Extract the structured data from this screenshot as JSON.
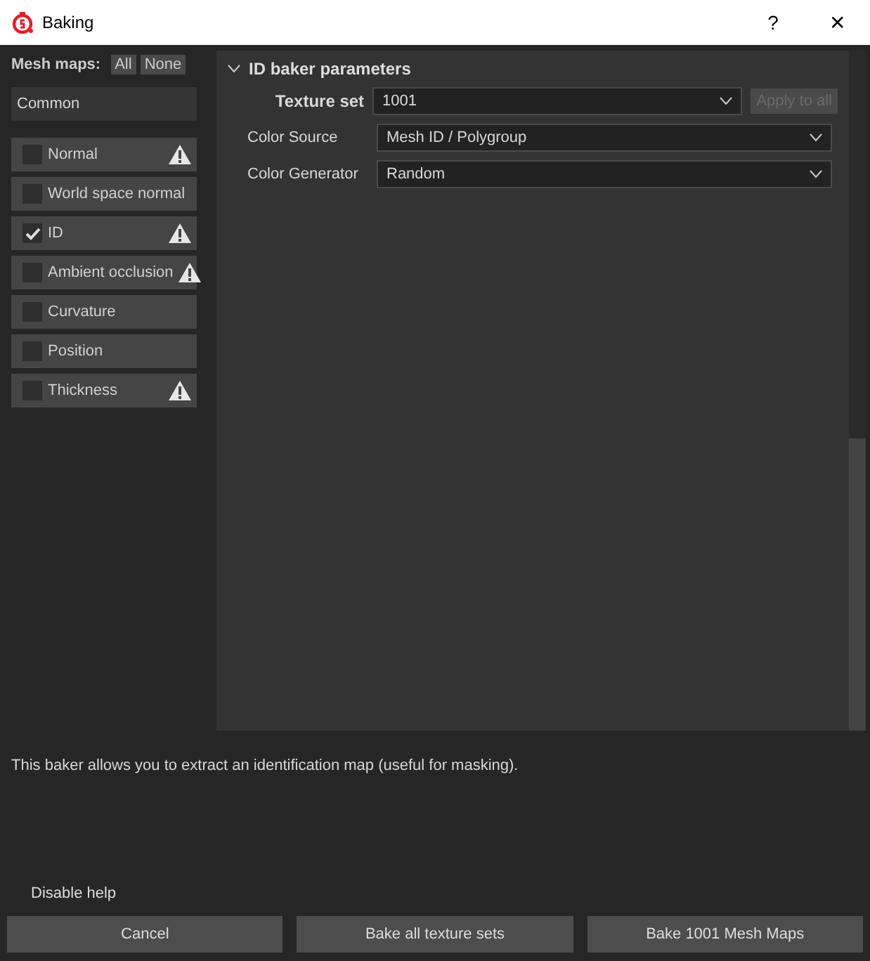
{
  "window": {
    "title": "Baking",
    "help": "?",
    "close": "✕"
  },
  "sidebar": {
    "label": "Mesh maps:",
    "buttons": [
      "All",
      "None"
    ],
    "group": "Common",
    "maps": [
      {
        "label": "Normal",
        "checked": false,
        "warning": true
      },
      {
        "label": "World space normal",
        "checked": false,
        "warning": false
      },
      {
        "label": "ID",
        "checked": true,
        "warning": true
      },
      {
        "label": "Ambient occlusion",
        "checked": false,
        "warning": true
      },
      {
        "label": "Curvature",
        "checked": false,
        "warning": false
      },
      {
        "label": "Position",
        "checked": false,
        "warning": false
      },
      {
        "label": "Thickness",
        "checked": false,
        "warning": true
      }
    ]
  },
  "panel": {
    "title": "ID baker parameters",
    "expanded": true,
    "texture_set": {
      "label": "Texture set",
      "value": "1001",
      "apply": {
        "label": "Apply to all",
        "disabled": true
      }
    },
    "fields": [
      {
        "label": "Color Source",
        "value": "Mesh ID / Polygroup"
      },
      {
        "label": "Color Generator",
        "value": "Random"
      }
    ]
  },
  "help_text": "This baker allows you to extract an identification map (useful for masking).",
  "disable_help": "Disable help",
  "buttons": [
    "Cancel",
    "Bake all texture sets",
    "Bake 1001 Mesh Maps"
  ]
}
